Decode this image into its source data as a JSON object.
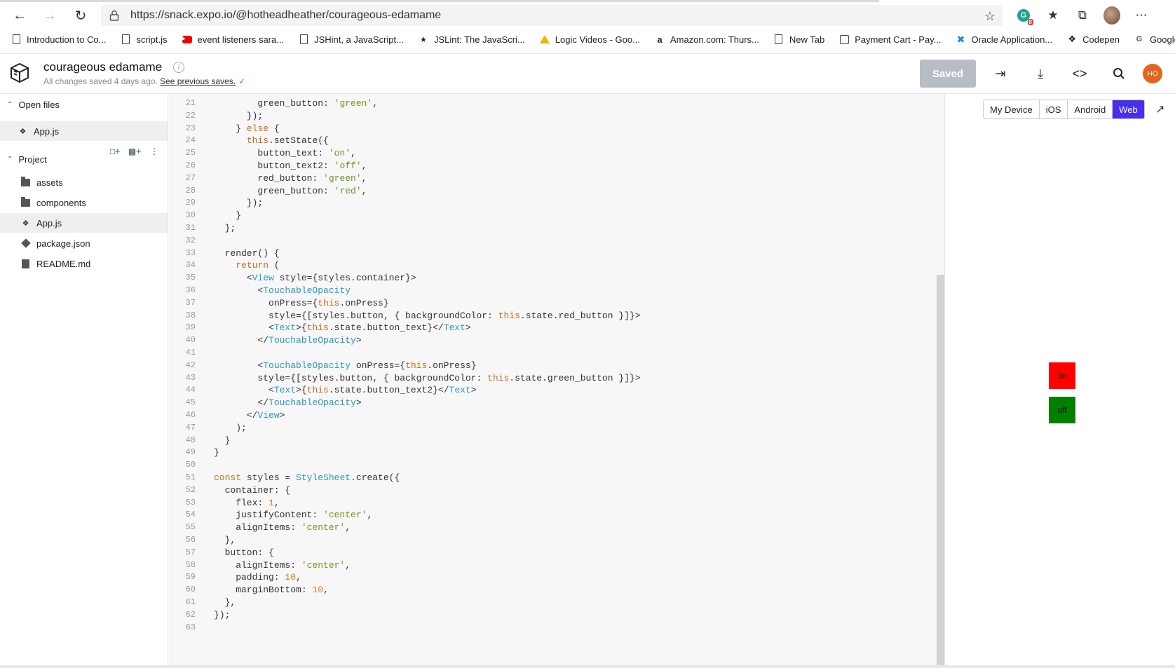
{
  "browser": {
    "url": "https://snack.expo.io/@hotheadheather/courageous-edamame",
    "extension_badge": "8",
    "bookmarks": [
      {
        "label": "Introduction to Co...",
        "icon": "document-icon"
      },
      {
        "label": "script.js",
        "icon": "document-icon"
      },
      {
        "label": "event listeners sara...",
        "icon": "youtube-icon"
      },
      {
        "label": "JSHint, a JavaScript...",
        "icon": "document-icon"
      },
      {
        "label": "JSLint: The JavaScri...",
        "icon": "jslint-icon"
      },
      {
        "label": "Logic Videos - Goo...",
        "icon": "google-drive-icon"
      },
      {
        "label": "Amazon.com: Thurs...",
        "icon": "amazon-icon"
      },
      {
        "label": "New Tab",
        "icon": "document-icon"
      },
      {
        "label": "Payment Cart - Pay...",
        "icon": "payment-icon"
      },
      {
        "label": "Oracle Application...",
        "icon": "oracle-icon"
      },
      {
        "label": "Codepen",
        "icon": "codepen-icon"
      },
      {
        "label": "Google",
        "icon": "google-icon"
      }
    ]
  },
  "header": {
    "title": "courageous edamame",
    "status_text": "All changes saved 4 days ago. ",
    "status_link": "See previous saves.",
    "saved_label": "Saved",
    "avatar_initials": "HO",
    "accent": "#4630eb",
    "avatar_color": "#e2651b"
  },
  "sidebar": {
    "open_files_label": "Open files",
    "open_files": [
      {
        "label": "App.js",
        "icon": "js-file-icon"
      }
    ],
    "project_label": "Project",
    "project_items": [
      {
        "label": "assets",
        "icon": "folder-icon"
      },
      {
        "label": "components",
        "icon": "folder-icon"
      },
      {
        "label": "App.js",
        "icon": "js-file-icon"
      },
      {
        "label": "package.json",
        "icon": "package-icon"
      },
      {
        "label": "README.md",
        "icon": "document-icon"
      }
    ]
  },
  "editor": {
    "lines": [
      {
        "n": "21",
        "t": "        green_button: 'green',"
      },
      {
        "n": "22",
        "t": "      });"
      },
      {
        "n": "23",
        "t": "    } else {"
      },
      {
        "n": "24",
        "t": "      this.setState({"
      },
      {
        "n": "25",
        "t": "        button_text: 'on',"
      },
      {
        "n": "26",
        "t": "        button_text2: 'off',"
      },
      {
        "n": "27",
        "t": "        red_button: 'green',"
      },
      {
        "n": "28",
        "t": "        green_button: 'red',"
      },
      {
        "n": "29",
        "t": "      });"
      },
      {
        "n": "30",
        "t": "    }"
      },
      {
        "n": "31",
        "t": "  };"
      },
      {
        "n": "32",
        "t": ""
      },
      {
        "n": "33",
        "t": "  render() {"
      },
      {
        "n": "34",
        "t": "    return ("
      },
      {
        "n": "35",
        "t": "      <View style={styles.container}>"
      },
      {
        "n": "36",
        "t": "        <TouchableOpacity"
      },
      {
        "n": "37",
        "t": "          onPress={this.onPress}"
      },
      {
        "n": "38",
        "t": "          style={[styles.button, { backgroundColor: this.state.red_button }]}>"
      },
      {
        "n": "39",
        "t": "          <Text>{this.state.button_text}</Text>"
      },
      {
        "n": "40",
        "t": "        </TouchableOpacity>"
      },
      {
        "n": "41",
        "t": ""
      },
      {
        "n": "42",
        "t": "        <TouchableOpacity onPress={this.onPress}"
      },
      {
        "n": "43",
        "t": "        style={[styles.button, { backgroundColor: this.state.green_button }]}>"
      },
      {
        "n": "44",
        "t": "          <Text>{this.state.button_text2}</Text>"
      },
      {
        "n": "45",
        "t": "        </TouchableOpacity>"
      },
      {
        "n": "46",
        "t": "      </View>"
      },
      {
        "n": "47",
        "t": "    );"
      },
      {
        "n": "48",
        "t": "  }"
      },
      {
        "n": "49",
        "t": "}"
      },
      {
        "n": "50",
        "t": ""
      },
      {
        "n": "51",
        "t": "const styles = StyleSheet.create({"
      },
      {
        "n": "52",
        "t": "  container: {"
      },
      {
        "n": "53",
        "t": "    flex: 1,"
      },
      {
        "n": "54",
        "t": "    justifyContent: 'center',"
      },
      {
        "n": "55",
        "t": "    alignItems: 'center',"
      },
      {
        "n": "56",
        "t": "  },"
      },
      {
        "n": "57",
        "t": "  button: {"
      },
      {
        "n": "58",
        "t": "    alignItems: 'center',"
      },
      {
        "n": "59",
        "t": "    padding: 10,"
      },
      {
        "n": "60",
        "t": "    marginBottom: 10,"
      },
      {
        "n": "61",
        "t": "  },"
      },
      {
        "n": "62",
        "t": "});"
      },
      {
        "n": "63",
        "t": ""
      }
    ]
  },
  "preview": {
    "platforms": [
      {
        "label": "My Device",
        "active": false
      },
      {
        "label": "iOS",
        "active": false
      },
      {
        "label": "Android",
        "active": false
      },
      {
        "label": "Web",
        "active": true
      }
    ],
    "buttons": [
      {
        "label": "on",
        "color": "#ff0000"
      },
      {
        "label": "off",
        "color": "#008000"
      }
    ]
  }
}
